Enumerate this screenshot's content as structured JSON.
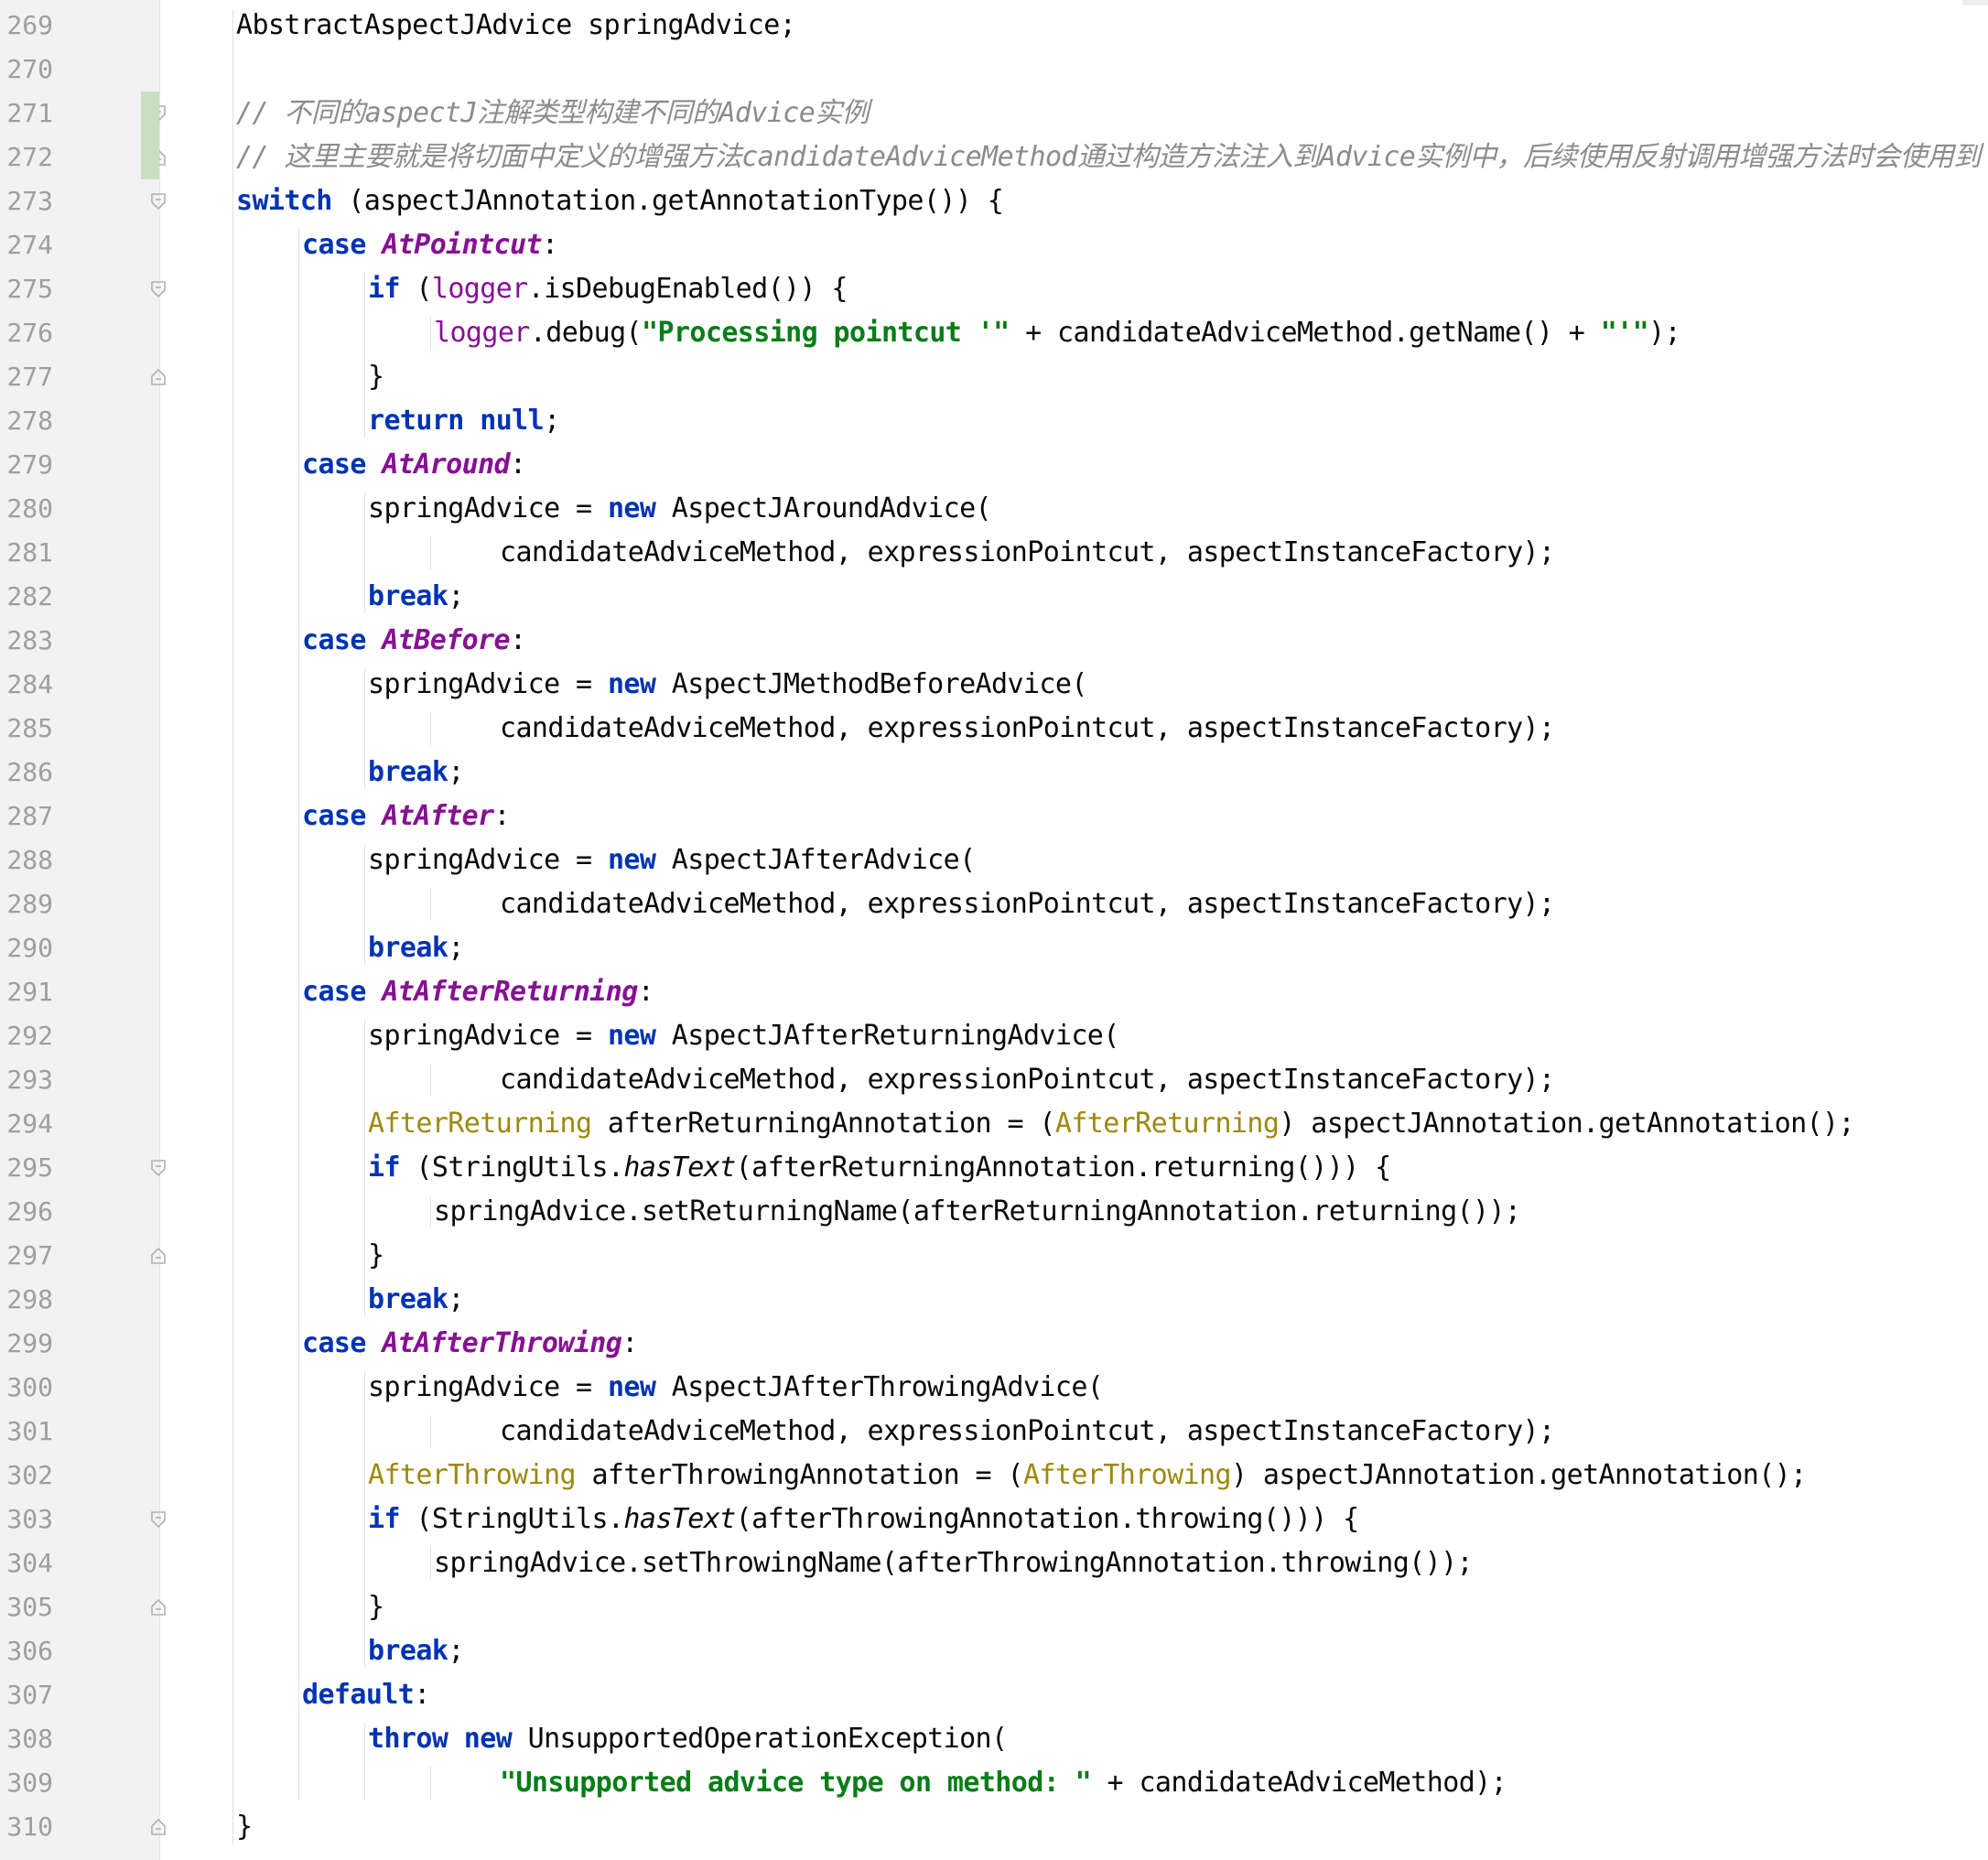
{
  "editor": {
    "lines": [
      {
        "n": "269",
        "indent": 0,
        "parts": [
          {
            "t": "AbstractAspectJAdvice springAdvice;",
            "c": "plain"
          }
        ]
      },
      {
        "n": "270",
        "indent": 0,
        "parts": []
      },
      {
        "n": "271",
        "indent": 0,
        "fold": "open",
        "parts": [
          {
            "t": "// 不同的",
            "c": "cm"
          },
          {
            "t": "aspectJ",
            "c": "cm"
          },
          {
            "t": "注解类型构建不同的",
            "c": "cm"
          },
          {
            "t": "Advice",
            "c": "cm"
          },
          {
            "t": "实例",
            "c": "cm"
          }
        ]
      },
      {
        "n": "272",
        "indent": 0,
        "fold": "close",
        "parts": [
          {
            "t": "// 这里主要就是将切面中定义的增强方法",
            "c": "cm"
          },
          {
            "t": "candidateAdviceMethod",
            "c": "cm"
          },
          {
            "t": "通过构造方法注入到",
            "c": "cm"
          },
          {
            "t": "Advice",
            "c": "cm"
          },
          {
            "t": "实例中，后续使用反射调用增强方法时会使用到",
            "c": "cm"
          }
        ]
      },
      {
        "n": "273",
        "indent": 0,
        "fold": "open",
        "parts": [
          {
            "t": "switch",
            "c": "kw"
          },
          {
            "t": " (aspectJAnnotation.getAnnotationType()) {",
            "c": "plain"
          }
        ]
      },
      {
        "n": "274",
        "indent": 1,
        "parts": [
          {
            "t": "case ",
            "c": "kw"
          },
          {
            "t": "AtPointcut",
            "c": "ev"
          },
          {
            "t": ":",
            "c": "plain"
          }
        ]
      },
      {
        "n": "275",
        "indent": 2,
        "fold": "open",
        "parts": [
          {
            "t": "if",
            "c": "kw"
          },
          {
            "t": " (",
            "c": "plain"
          },
          {
            "t": "logger",
            "c": "fld"
          },
          {
            "t": ".isDebugEnabled()) {",
            "c": "plain"
          }
        ]
      },
      {
        "n": "276",
        "indent": 3,
        "parts": [
          {
            "t": "logger",
            "c": "fld"
          },
          {
            "t": ".debug(",
            "c": "plain"
          },
          {
            "t": "\"Processing pointcut '\"",
            "c": "str"
          },
          {
            "t": " + candidateAdviceMethod.getName() + ",
            "c": "plain"
          },
          {
            "t": "\"'\"",
            "c": "str"
          },
          {
            "t": ");",
            "c": "plain"
          }
        ]
      },
      {
        "n": "277",
        "indent": 2,
        "fold": "close",
        "parts": [
          {
            "t": "}",
            "c": "plain"
          }
        ]
      },
      {
        "n": "278",
        "indent": 2,
        "parts": [
          {
            "t": "return null",
            "c": "kw"
          },
          {
            "t": ";",
            "c": "plain"
          }
        ]
      },
      {
        "n": "279",
        "indent": 1,
        "parts": [
          {
            "t": "case ",
            "c": "kw"
          },
          {
            "t": "AtAround",
            "c": "ev"
          },
          {
            "t": ":",
            "c": "plain"
          }
        ]
      },
      {
        "n": "280",
        "indent": 2,
        "parts": [
          {
            "t": "springAdvice = ",
            "c": "plain"
          },
          {
            "t": "new",
            "c": "kw"
          },
          {
            "t": " AspectJAroundAdvice(",
            "c": "plain"
          }
        ]
      },
      {
        "n": "281",
        "indent": 4,
        "parts": [
          {
            "t": "candidateAdviceMethod, expressionPointcut, aspectInstanceFactory);",
            "c": "plain"
          }
        ]
      },
      {
        "n": "282",
        "indent": 2,
        "parts": [
          {
            "t": "break",
            "c": "kw"
          },
          {
            "t": ";",
            "c": "plain"
          }
        ]
      },
      {
        "n": "283",
        "indent": 1,
        "parts": [
          {
            "t": "case ",
            "c": "kw"
          },
          {
            "t": "AtBefore",
            "c": "ev"
          },
          {
            "t": ":",
            "c": "plain"
          }
        ]
      },
      {
        "n": "284",
        "indent": 2,
        "parts": [
          {
            "t": "springAdvice = ",
            "c": "plain"
          },
          {
            "t": "new",
            "c": "kw"
          },
          {
            "t": " AspectJMethodBeforeAdvice(",
            "c": "plain"
          }
        ]
      },
      {
        "n": "285",
        "indent": 4,
        "parts": [
          {
            "t": "candidateAdviceMethod, expressionPointcut, aspectInstanceFactory);",
            "c": "plain"
          }
        ]
      },
      {
        "n": "286",
        "indent": 2,
        "parts": [
          {
            "t": "break",
            "c": "kw"
          },
          {
            "t": ";",
            "c": "plain"
          }
        ]
      },
      {
        "n": "287",
        "indent": 1,
        "parts": [
          {
            "t": "case ",
            "c": "kw"
          },
          {
            "t": "AtAfter",
            "c": "ev"
          },
          {
            "t": ":",
            "c": "plain"
          }
        ]
      },
      {
        "n": "288",
        "indent": 2,
        "parts": [
          {
            "t": "springAdvice = ",
            "c": "plain"
          },
          {
            "t": "new",
            "c": "kw"
          },
          {
            "t": " AspectJAfterAdvice(",
            "c": "plain"
          }
        ]
      },
      {
        "n": "289",
        "indent": 4,
        "parts": [
          {
            "t": "candidateAdviceMethod, expressionPointcut, aspectInstanceFactory);",
            "c": "plain"
          }
        ]
      },
      {
        "n": "290",
        "indent": 2,
        "parts": [
          {
            "t": "break",
            "c": "kw"
          },
          {
            "t": ";",
            "c": "plain"
          }
        ]
      },
      {
        "n": "291",
        "indent": 1,
        "parts": [
          {
            "t": "case ",
            "c": "kw"
          },
          {
            "t": "AtAfterReturning",
            "c": "ev"
          },
          {
            "t": ":",
            "c": "plain"
          }
        ]
      },
      {
        "n": "292",
        "indent": 2,
        "parts": [
          {
            "t": "springAdvice = ",
            "c": "plain"
          },
          {
            "t": "new",
            "c": "kw"
          },
          {
            "t": " AspectJAfterReturningAdvice(",
            "c": "plain"
          }
        ]
      },
      {
        "n": "293",
        "indent": 4,
        "parts": [
          {
            "t": "candidateAdviceMethod, expressionPointcut, aspectInstanceFactory);",
            "c": "plain"
          }
        ]
      },
      {
        "n": "294",
        "indent": 2,
        "parts": [
          {
            "t": "AfterReturning",
            "c": "ann"
          },
          {
            "t": " afterReturningAnnotation = (",
            "c": "plain"
          },
          {
            "t": "AfterReturning",
            "c": "ann"
          },
          {
            "t": ") aspectJAnnotation.getAnnotation();",
            "c": "plain"
          }
        ]
      },
      {
        "n": "295",
        "indent": 2,
        "fold": "open",
        "parts": [
          {
            "t": "if",
            "c": "kw"
          },
          {
            "t": " (StringUtils.",
            "c": "plain"
          },
          {
            "t": "hasText",
            "c": "st"
          },
          {
            "t": "(afterReturningAnnotation.returning())) {",
            "c": "plain"
          }
        ]
      },
      {
        "n": "296",
        "indent": 3,
        "parts": [
          {
            "t": "springAdvice.setReturningName(afterReturningAnnotation.returning());",
            "c": "plain"
          }
        ]
      },
      {
        "n": "297",
        "indent": 2,
        "fold": "close",
        "parts": [
          {
            "t": "}",
            "c": "plain"
          }
        ]
      },
      {
        "n": "298",
        "indent": 2,
        "parts": [
          {
            "t": "break",
            "c": "kw"
          },
          {
            "t": ";",
            "c": "plain"
          }
        ]
      },
      {
        "n": "299",
        "indent": 1,
        "parts": [
          {
            "t": "case ",
            "c": "kw"
          },
          {
            "t": "AtAfterThrowing",
            "c": "ev"
          },
          {
            "t": ":",
            "c": "plain"
          }
        ]
      },
      {
        "n": "300",
        "indent": 2,
        "parts": [
          {
            "t": "springAdvice = ",
            "c": "plain"
          },
          {
            "t": "new",
            "c": "kw"
          },
          {
            "t": " AspectJAfterThrowingAdvice(",
            "c": "plain"
          }
        ]
      },
      {
        "n": "301",
        "indent": 4,
        "parts": [
          {
            "t": "candidateAdviceMethod, expressionPointcut, aspectInstanceFactory);",
            "c": "plain"
          }
        ]
      },
      {
        "n": "302",
        "indent": 2,
        "parts": [
          {
            "t": "AfterThrowing",
            "c": "ann"
          },
          {
            "t": " afterThrowingAnnotation = (",
            "c": "plain"
          },
          {
            "t": "AfterThrowing",
            "c": "ann"
          },
          {
            "t": ") aspectJAnnotation.getAnnotation();",
            "c": "plain"
          }
        ]
      },
      {
        "n": "303",
        "indent": 2,
        "fold": "open",
        "parts": [
          {
            "t": "if",
            "c": "kw"
          },
          {
            "t": " (StringUtils.",
            "c": "plain"
          },
          {
            "t": "hasText",
            "c": "st"
          },
          {
            "t": "(afterThrowingAnnotation.throwing())) {",
            "c": "plain"
          }
        ]
      },
      {
        "n": "304",
        "indent": 3,
        "parts": [
          {
            "t": "springAdvice.setThrowingName(afterThrowingAnnotation.throwing());",
            "c": "plain"
          }
        ]
      },
      {
        "n": "305",
        "indent": 2,
        "fold": "close",
        "parts": [
          {
            "t": "}",
            "c": "plain"
          }
        ]
      },
      {
        "n": "306",
        "indent": 2,
        "parts": [
          {
            "t": "break",
            "c": "kw"
          },
          {
            "t": ";",
            "c": "plain"
          }
        ]
      },
      {
        "n": "307",
        "indent": 1,
        "parts": [
          {
            "t": "default",
            "c": "kw"
          },
          {
            "t": ":",
            "c": "plain"
          }
        ]
      },
      {
        "n": "308",
        "indent": 2,
        "parts": [
          {
            "t": "throw new",
            "c": "kw"
          },
          {
            "t": " UnsupportedOperationException(",
            "c": "plain"
          }
        ]
      },
      {
        "n": "309",
        "indent": 4,
        "parts": [
          {
            "t": "\"Unsupported advice type on method: \"",
            "c": "str"
          },
          {
            "t": " + candidateAdviceMethod);",
            "c": "plain"
          }
        ]
      },
      {
        "n": "310",
        "indent": 0,
        "fold": "close",
        "parts": [
          {
            "t": "}",
            "c": "plain"
          }
        ]
      }
    ]
  },
  "colors": {
    "keyword": "#0033b3",
    "comment": "#8c8c8c",
    "enum_value": "#871094",
    "string": "#067d17",
    "annotation_type": "#9e880d",
    "gutter_bg": "#f2f2f2",
    "change_marker": "#c9dfc1"
  }
}
